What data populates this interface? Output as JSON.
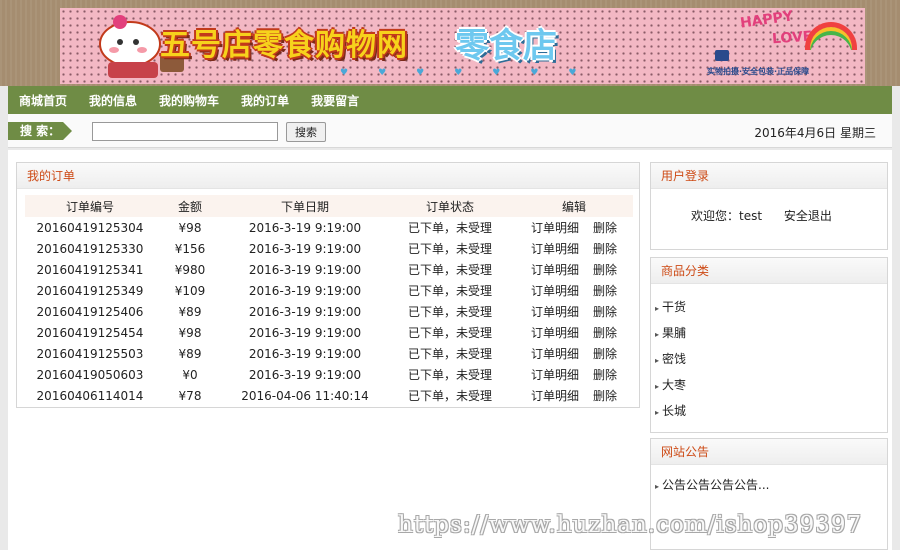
{
  "banner": {
    "brand": "五号店零食购物网",
    "brand_sub": "零食店",
    "happy": "HAPPY",
    "love": "LOVE",
    "tagline": "实物拍摄·安全包装·正品保障"
  },
  "nav": {
    "items": [
      "商城首页",
      "我的信息",
      "我的购物车",
      "我的订单",
      "我要留言"
    ]
  },
  "search": {
    "tag": "搜 索：",
    "button": "搜索",
    "value": "",
    "placeholder": ""
  },
  "date_text": "2016年4月6日 星期三",
  "orders": {
    "title": "我的订单",
    "columns": [
      "订单编号",
      "金额",
      "下单日期",
      "订单状态",
      "编辑"
    ],
    "rows": [
      {
        "id": "20160419125304",
        "amount": "¥98",
        "date": "2016-3-19 9:19:00",
        "status": "已下单，未受理",
        "detail": "订单明细",
        "delete": "删除"
      },
      {
        "id": "20160419125330",
        "amount": "¥156",
        "date": "2016-3-19 9:19:00",
        "status": "已下单，未受理",
        "detail": "订单明细",
        "delete": "删除"
      },
      {
        "id": "20160419125341",
        "amount": "¥980",
        "date": "2016-3-19 9:19:00",
        "status": "已下单，未受理",
        "detail": "订单明细",
        "delete": "删除"
      },
      {
        "id": "20160419125349",
        "amount": "¥109",
        "date": "2016-3-19 9:19:00",
        "status": "已下单，未受理",
        "detail": "订单明细",
        "delete": "删除"
      },
      {
        "id": "20160419125406",
        "amount": "¥89",
        "date": "2016-3-19 9:19:00",
        "status": "已下单，未受理",
        "detail": "订单明细",
        "delete": "删除"
      },
      {
        "id": "20160419125454",
        "amount": "¥98",
        "date": "2016-3-19 9:19:00",
        "status": "已下单，未受理",
        "detail": "订单明细",
        "delete": "删除"
      },
      {
        "id": "20160419125503",
        "amount": "¥89",
        "date": "2016-3-19 9:19:00",
        "status": "已下单，未受理",
        "detail": "订单明细",
        "delete": "删除"
      },
      {
        "id": "20160419050603",
        "amount": "¥0",
        "date": "2016-3-19 9:19:00",
        "status": "已下单，未受理",
        "detail": "订单明细",
        "delete": "删除"
      },
      {
        "id": "20160406114014",
        "amount": "¥78",
        "date": "2016-04-06 11:40:14",
        "status": "已下单，未受理",
        "detail": "订单明细",
        "delete": "删除"
      }
    ]
  },
  "login": {
    "title": "用户登录",
    "welcome": "欢迎您：test",
    "logout": "安全退出"
  },
  "categories": {
    "title": "商品分类",
    "items": [
      "干货",
      "果脯",
      "密饯",
      "大枣",
      "长城"
    ]
  },
  "notice": {
    "title": "网站公告",
    "items": [
      "公告公告公告公告..."
    ]
  },
  "watermark": "https://www.huzhan.com/ishop39397",
  "colors": {
    "nav_green": "#6f8c45",
    "panel_title": "#cd4a15"
  }
}
